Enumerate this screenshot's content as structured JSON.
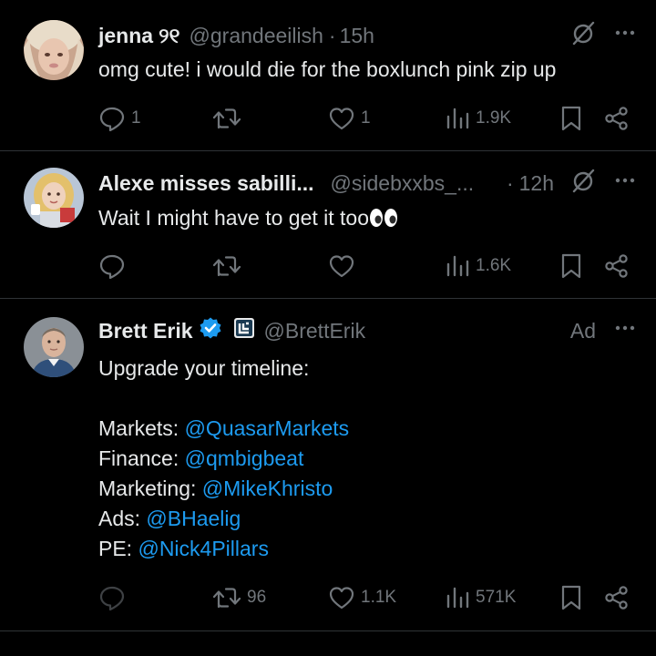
{
  "tweets": [
    {
      "display_name": "jenna",
      "name_badge": "୨୧",
      "handle": "@grandeeilish",
      "time": "15h",
      "text": "omg cute! i would die for the boxlunch pink zip up",
      "replies": "1",
      "reposts": "",
      "likes": "1",
      "views": "1.9K"
    },
    {
      "display_name": "Alexe misses sabilli...",
      "handle": "@sidebxxbs_...",
      "time": "12h",
      "text": "Wait I might have to get it too",
      "text_emoji": "eyes",
      "replies": "",
      "reposts": "",
      "likes": "",
      "views": "1.6K"
    },
    {
      "display_name": "Brett Erik",
      "handle": "@BrettErik",
      "ad_label": "Ad",
      "intro": "Upgrade your timeline:",
      "lines": [
        {
          "label": "Markets: ",
          "mention": "@QuasarMarkets"
        },
        {
          "label": "Finance: ",
          "mention": "@qmbigbeat"
        },
        {
          "label": "Marketing: ",
          "mention": "@MikeKhristo"
        },
        {
          "label": "Ads: ",
          "mention": "@BHaelig"
        },
        {
          "label": "PE: ",
          "mention": "@Nick4Pillars"
        }
      ],
      "replies": "",
      "reposts": "96",
      "likes": "1.1K",
      "views": "571K"
    }
  ],
  "colors": {
    "background": "#000000",
    "text": "#e7e9ea",
    "muted": "#71767b",
    "mention": "#1d9bf0",
    "verified": "#1d9bf0",
    "divider": "#2f3336"
  },
  "icons": [
    "grok-icon",
    "more-icon",
    "reply-icon",
    "repost-icon",
    "like-icon",
    "views-icon",
    "bookmark-icon",
    "share-icon",
    "verified-badge-icon",
    "affiliate-badge-icon"
  ]
}
